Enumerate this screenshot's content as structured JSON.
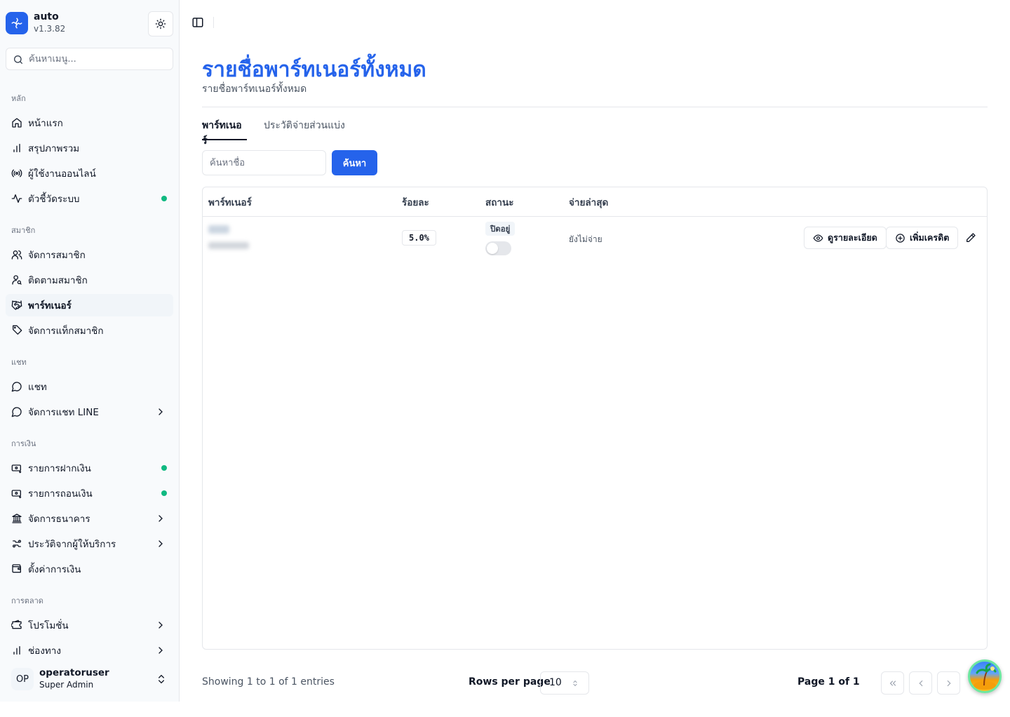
{
  "app": {
    "name": "auto",
    "version": "v1.3.82"
  },
  "sidebar": {
    "search_placeholder": "ค้นหาเมนู...",
    "sections": [
      {
        "label": "หลัก",
        "items": [
          {
            "label": "หน้าแรก",
            "icon": "home-icon"
          },
          {
            "label": "สรุปภาพรวม",
            "icon": "bar-chart-icon"
          },
          {
            "label": "ผู้ใช้งานออนไลน์",
            "icon": "radio-icon"
          },
          {
            "label": "ตัวชี้วัดระบบ",
            "icon": "activity-icon",
            "status": "online"
          }
        ]
      },
      {
        "label": "สมาชิก",
        "items": [
          {
            "label": "จัดการสมาชิก",
            "icon": "users-icon"
          },
          {
            "label": "ติดตามสมาชิก",
            "icon": "user-search-icon"
          },
          {
            "label": "พาร์ทเนอร์",
            "icon": "handshake-icon",
            "active": true
          },
          {
            "label": "จัดการแท็กสมาชิก",
            "icon": "tag-icon"
          }
        ]
      },
      {
        "label": "แชท",
        "items": [
          {
            "label": "แชท",
            "icon": "message-circle-icon"
          },
          {
            "label": "จัดการแชท LINE",
            "icon": "message-circle-icon",
            "expandable": true
          }
        ]
      },
      {
        "label": "การเงิน",
        "items": [
          {
            "label": "รายการฝากเงิน",
            "icon": "money-in-icon",
            "status": "online"
          },
          {
            "label": "รายการถอนเงิน",
            "icon": "money-out-icon",
            "status": "online"
          },
          {
            "label": "จัดการธนาคาร",
            "icon": "bank-icon",
            "expandable": true
          },
          {
            "label": "ประวัติจากผู้ให้บริการ",
            "icon": "history-icon",
            "expandable": true
          },
          {
            "label": "ตั้งค่าการเงิน",
            "icon": "wallet-icon"
          }
        ]
      },
      {
        "label": "การตลาด",
        "items": [
          {
            "label": "โปรโมชั่น",
            "icon": "ticket-icon",
            "expandable": true
          },
          {
            "label": "ช่องทาง",
            "icon": "bar-chart-icon",
            "expandable": true
          }
        ]
      }
    ],
    "user": {
      "initials": "OP",
      "name": "operatoruser",
      "role": "Super Admin"
    }
  },
  "main": {
    "title": "รายชื่อพาร์ทเนอร์ทั้งหมด",
    "subtitle": "รายชื่อพาร์ทเนอร์ทั้งหมด",
    "tabs": [
      {
        "label": "พาร์ทเนอร์",
        "active": true
      },
      {
        "label": "ประวัติจ่ายส่วนแบ่ง",
        "active": false
      }
    ],
    "search": {
      "placeholder": "ค้นหาชื่อ",
      "button": "ค้นหา"
    },
    "table": {
      "columns": [
        "พาร์ทเนอร์",
        "ร้อยละ",
        "สถานะ",
        "จ่ายล่าสุด"
      ],
      "rows": [
        {
          "partner_redacted": true,
          "percent": "5.0%",
          "status": "ปิดอยู่",
          "enabled": false,
          "last_paid": "ยังไม่จ่าย",
          "actions": {
            "view": "ดูรายละเอียด",
            "add_credit": "เพิ่มเครดิต"
          }
        }
      ]
    },
    "footer": {
      "showing": "Showing 1 to 1 of 1 entries",
      "rows_per_page_label": "Rows per page",
      "rows_per_page": "10",
      "page_info": "Page 1 of 1"
    }
  },
  "colors": {
    "accent": "#2563eb",
    "status_online": "#10b981"
  }
}
